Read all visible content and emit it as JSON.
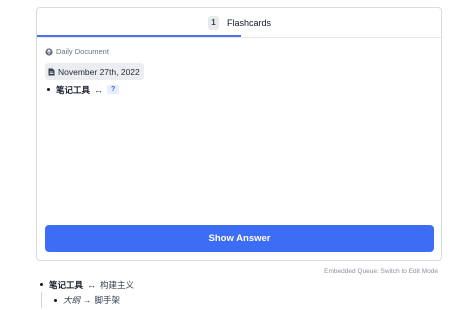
{
  "tabs": [
    {
      "count": "1",
      "label": "Flashcards"
    }
  ],
  "card": {
    "source_label": "Daily Document",
    "source_icon": "circle-arrow-icon",
    "date": "November 27th, 2022",
    "date_icon": "document-icon",
    "front": "笔记工具",
    "arrow": "↔",
    "cloze": "?"
  },
  "actions": {
    "show_answer": "Show Answer"
  },
  "queue_link": "Embedded Queue: Switch to Edit Mode",
  "outline": {
    "line1_front": "笔记工具",
    "line1_arrow": "↔",
    "line1_back": "构建主义",
    "line2_left": "大纲",
    "line2_arrow": "→",
    "line2_right": "脚手架"
  },
  "colors": {
    "accent": "#3d6df5",
    "tab_underline": "#4a74e8"
  }
}
